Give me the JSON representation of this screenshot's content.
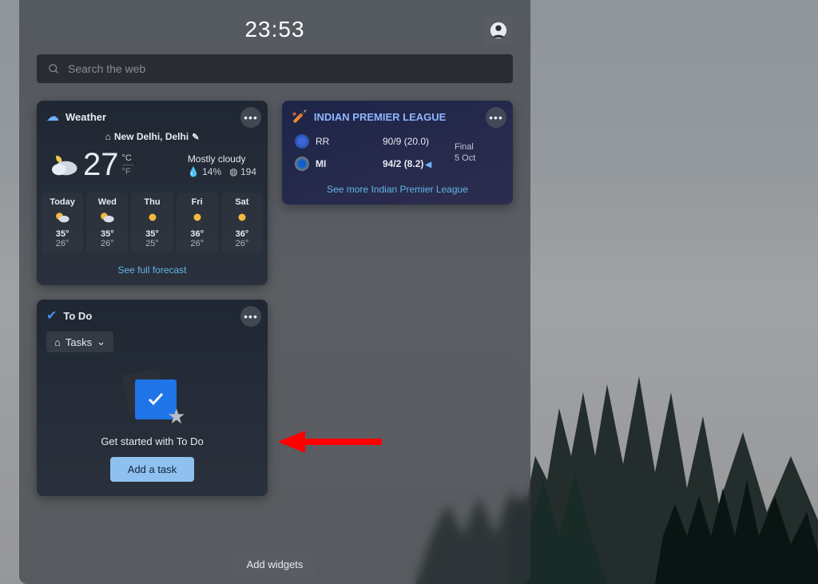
{
  "header": {
    "time": "23:53"
  },
  "search": {
    "placeholder": "Search the web"
  },
  "weather": {
    "title": "Weather",
    "location": "New Delhi, Delhi",
    "temp": "27",
    "unit_primary": "°C",
    "unit_secondary": "°F",
    "condition": "Mostly cloudy",
    "humidity": "14%",
    "aqi": "194",
    "forecast": [
      {
        "name": "Today",
        "icon": "partly-night",
        "hi": "35°",
        "lo": "26°"
      },
      {
        "name": "Wed",
        "icon": "partly-night",
        "hi": "35°",
        "lo": "26°"
      },
      {
        "name": "Thu",
        "icon": "sunny",
        "hi": "35°",
        "lo": "25°"
      },
      {
        "name": "Fri",
        "icon": "sunny",
        "hi": "36°",
        "lo": "26°"
      },
      {
        "name": "Sat",
        "icon": "sunny",
        "hi": "36°",
        "lo": "26°"
      }
    ],
    "footer_link": "See full forecast"
  },
  "sports": {
    "title": "INDIAN PREMIER LEAGUE",
    "teams": [
      {
        "abbr": "RR",
        "score": "90/9 (20.0)",
        "bold": false
      },
      {
        "abbr": "MI",
        "score": "94/2 (8.2)",
        "bold": true
      }
    ],
    "status_line1": "Final",
    "status_line2": "5 Oct",
    "footer_link": "See more Indian Premier League"
  },
  "todo": {
    "title": "To Do",
    "list_chip": "Tasks",
    "subtitle": "Get started with To Do",
    "button": "Add a task"
  },
  "footer": {
    "add_widgets": "Add widgets"
  }
}
